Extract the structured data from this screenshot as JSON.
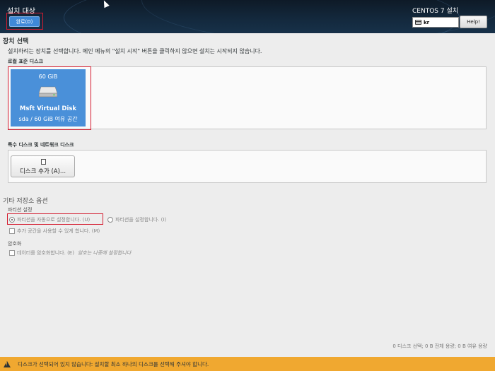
{
  "header": {
    "title": "설치 대상",
    "done_label": "완료(D)",
    "product": "CENTOS 7 설치",
    "keyboard_layout": "kr",
    "help_label": "Help!"
  },
  "device_selection": {
    "title": "장치 선택",
    "description": "설치하려는 장치를 선택합니다. 메인 메뉴의 \"설치 시작\" 버튼을 클릭하지 않으면 설치는 시작되지 않습니다.",
    "local_label": "로컬 표준 디스크",
    "disks": [
      {
        "size": "60 GiB",
        "name": "Msft Virtual Disk",
        "info": "sda / 60 GiB 여유 공간"
      }
    ],
    "special_label": "특수 디스크 및 네트워크 디스크",
    "add_disk_label": "디스크 추가 (A)..."
  },
  "other_options": {
    "title": "기타 저장소 옵션",
    "partition_label": "파티션 설정",
    "auto_partition_label": "파티션을 자동으로 설정합니다. (U)",
    "manual_partition_label": "파티션을 설정합니다. (I)",
    "extra_space_label": "추가 공간을 사용할 수 있게 합니다. (M)",
    "encryption_label": "암호화",
    "encrypt_data_label": "데이터를 암호화합니다. (E)",
    "encrypt_note": "암호는 나중에 설정합니다"
  },
  "summary": "0 디스크 선택; 0 B 전체 용량; 0 B 여유 용량",
  "warning": "디스크가 선택되어 있지 않습니다: 설치할 최소 하나의 디스크를 선택해 주셔야 합니다.",
  "colors": {
    "header_bg": "#13283c",
    "accent_blue": "#4a90d9",
    "highlight_red": "#d41c2f",
    "warning_bg": "#f0a830"
  }
}
